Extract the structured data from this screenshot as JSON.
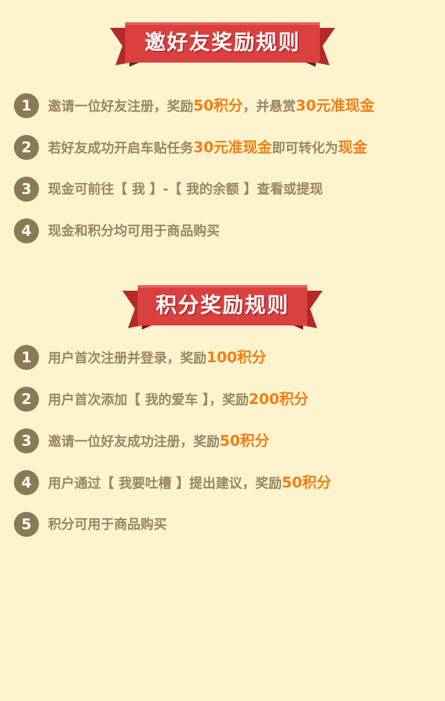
{
  "colors": {
    "background": "#fdf4cf",
    "banner_red": "#d9403f",
    "banner_dark": "#b32a28",
    "number_circle": "#8a7a55",
    "text": "#9a8663",
    "highlight": "#f57e14"
  },
  "invite_section": {
    "title": "邀好友奖励规则",
    "rules": [
      {
        "number": "1",
        "segments": [
          {
            "text": "邀请一位好友注册，奖励",
            "highlight": false
          },
          {
            "text": "50积分",
            "highlight": true
          },
          {
            "text": "，并悬赏",
            "highlight": false
          },
          {
            "text": "30元准现金",
            "highlight": true
          }
        ]
      },
      {
        "number": "2",
        "segments": [
          {
            "text": "若好友成功开启车贴任务",
            "highlight": false
          },
          {
            "text": "30元准现金",
            "highlight": true
          },
          {
            "text": "即可转化为",
            "highlight": false
          },
          {
            "text": "现金",
            "highlight": true
          }
        ]
      },
      {
        "number": "3",
        "segments": [
          {
            "text": "现金可前往【 我 】-【 我的余额 】查看或提现",
            "highlight": false
          }
        ]
      },
      {
        "number": "4",
        "segments": [
          {
            "text": "现金和积分均可用于商品购买",
            "highlight": false
          }
        ]
      }
    ]
  },
  "points_section": {
    "title": "积分奖励规则",
    "rules": [
      {
        "number": "1",
        "segments": [
          {
            "text": "用户首次注册并登录，奖励",
            "highlight": false
          },
          {
            "text": "100积分",
            "highlight": true
          }
        ]
      },
      {
        "number": "2",
        "segments": [
          {
            "text": "用户首次添加【 我的爱车 】，奖励",
            "highlight": false
          },
          {
            "text": "200积分",
            "highlight": true
          }
        ]
      },
      {
        "number": "3",
        "segments": [
          {
            "text": "邀请一位好友成功注册，奖励",
            "highlight": false
          },
          {
            "text": "50积分",
            "highlight": true
          }
        ]
      },
      {
        "number": "4",
        "segments": [
          {
            "text": "用户通过【 我要吐槽 】提出建议，奖励",
            "highlight": false
          },
          {
            "text": "50积分",
            "highlight": true
          }
        ]
      },
      {
        "number": "5",
        "segments": [
          {
            "text": "积分可用于商品购买",
            "highlight": false
          }
        ]
      }
    ]
  }
}
